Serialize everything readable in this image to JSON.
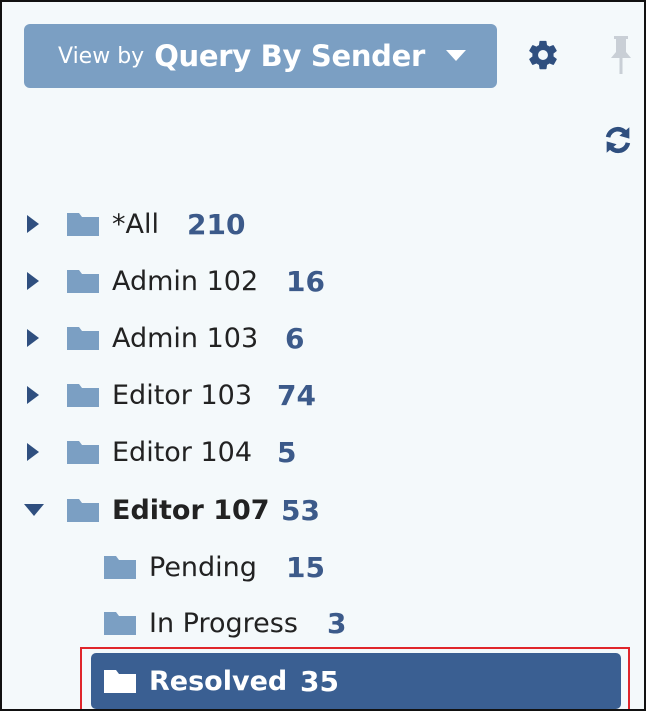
{
  "header": {
    "view_by_prefix": "View by",
    "view_by_value": "Query By Sender",
    "dropdown_icon": "caret-down-icon",
    "settings_icon": "gear-icon",
    "pin_icon": "pin-icon",
    "refresh_icon": "refresh-icon"
  },
  "colors": {
    "accent": "#7b9fc3",
    "selected": "#3a5f92",
    "count": "#3c5a8a",
    "folder": "#7b9fc3",
    "highlight_outline": "#e0262b"
  },
  "tree": {
    "items": [
      {
        "label": "*All",
        "count": "210",
        "expanded": false
      },
      {
        "label": "Admin 102",
        "count": "16",
        "expanded": false
      },
      {
        "label": "Admin 103",
        "count": "6",
        "expanded": false
      },
      {
        "label": "Editor 103",
        "count": "74",
        "expanded": false
      },
      {
        "label": "Editor 104",
        "count": "5",
        "expanded": false
      },
      {
        "label": "Editor 107",
        "count": "53",
        "expanded": true,
        "children": [
          {
            "label": "Pending",
            "count": "15"
          },
          {
            "label": "In Progress",
            "count": "3"
          },
          {
            "label": "Resolved",
            "count": "35",
            "selected": true
          }
        ]
      }
    ]
  }
}
